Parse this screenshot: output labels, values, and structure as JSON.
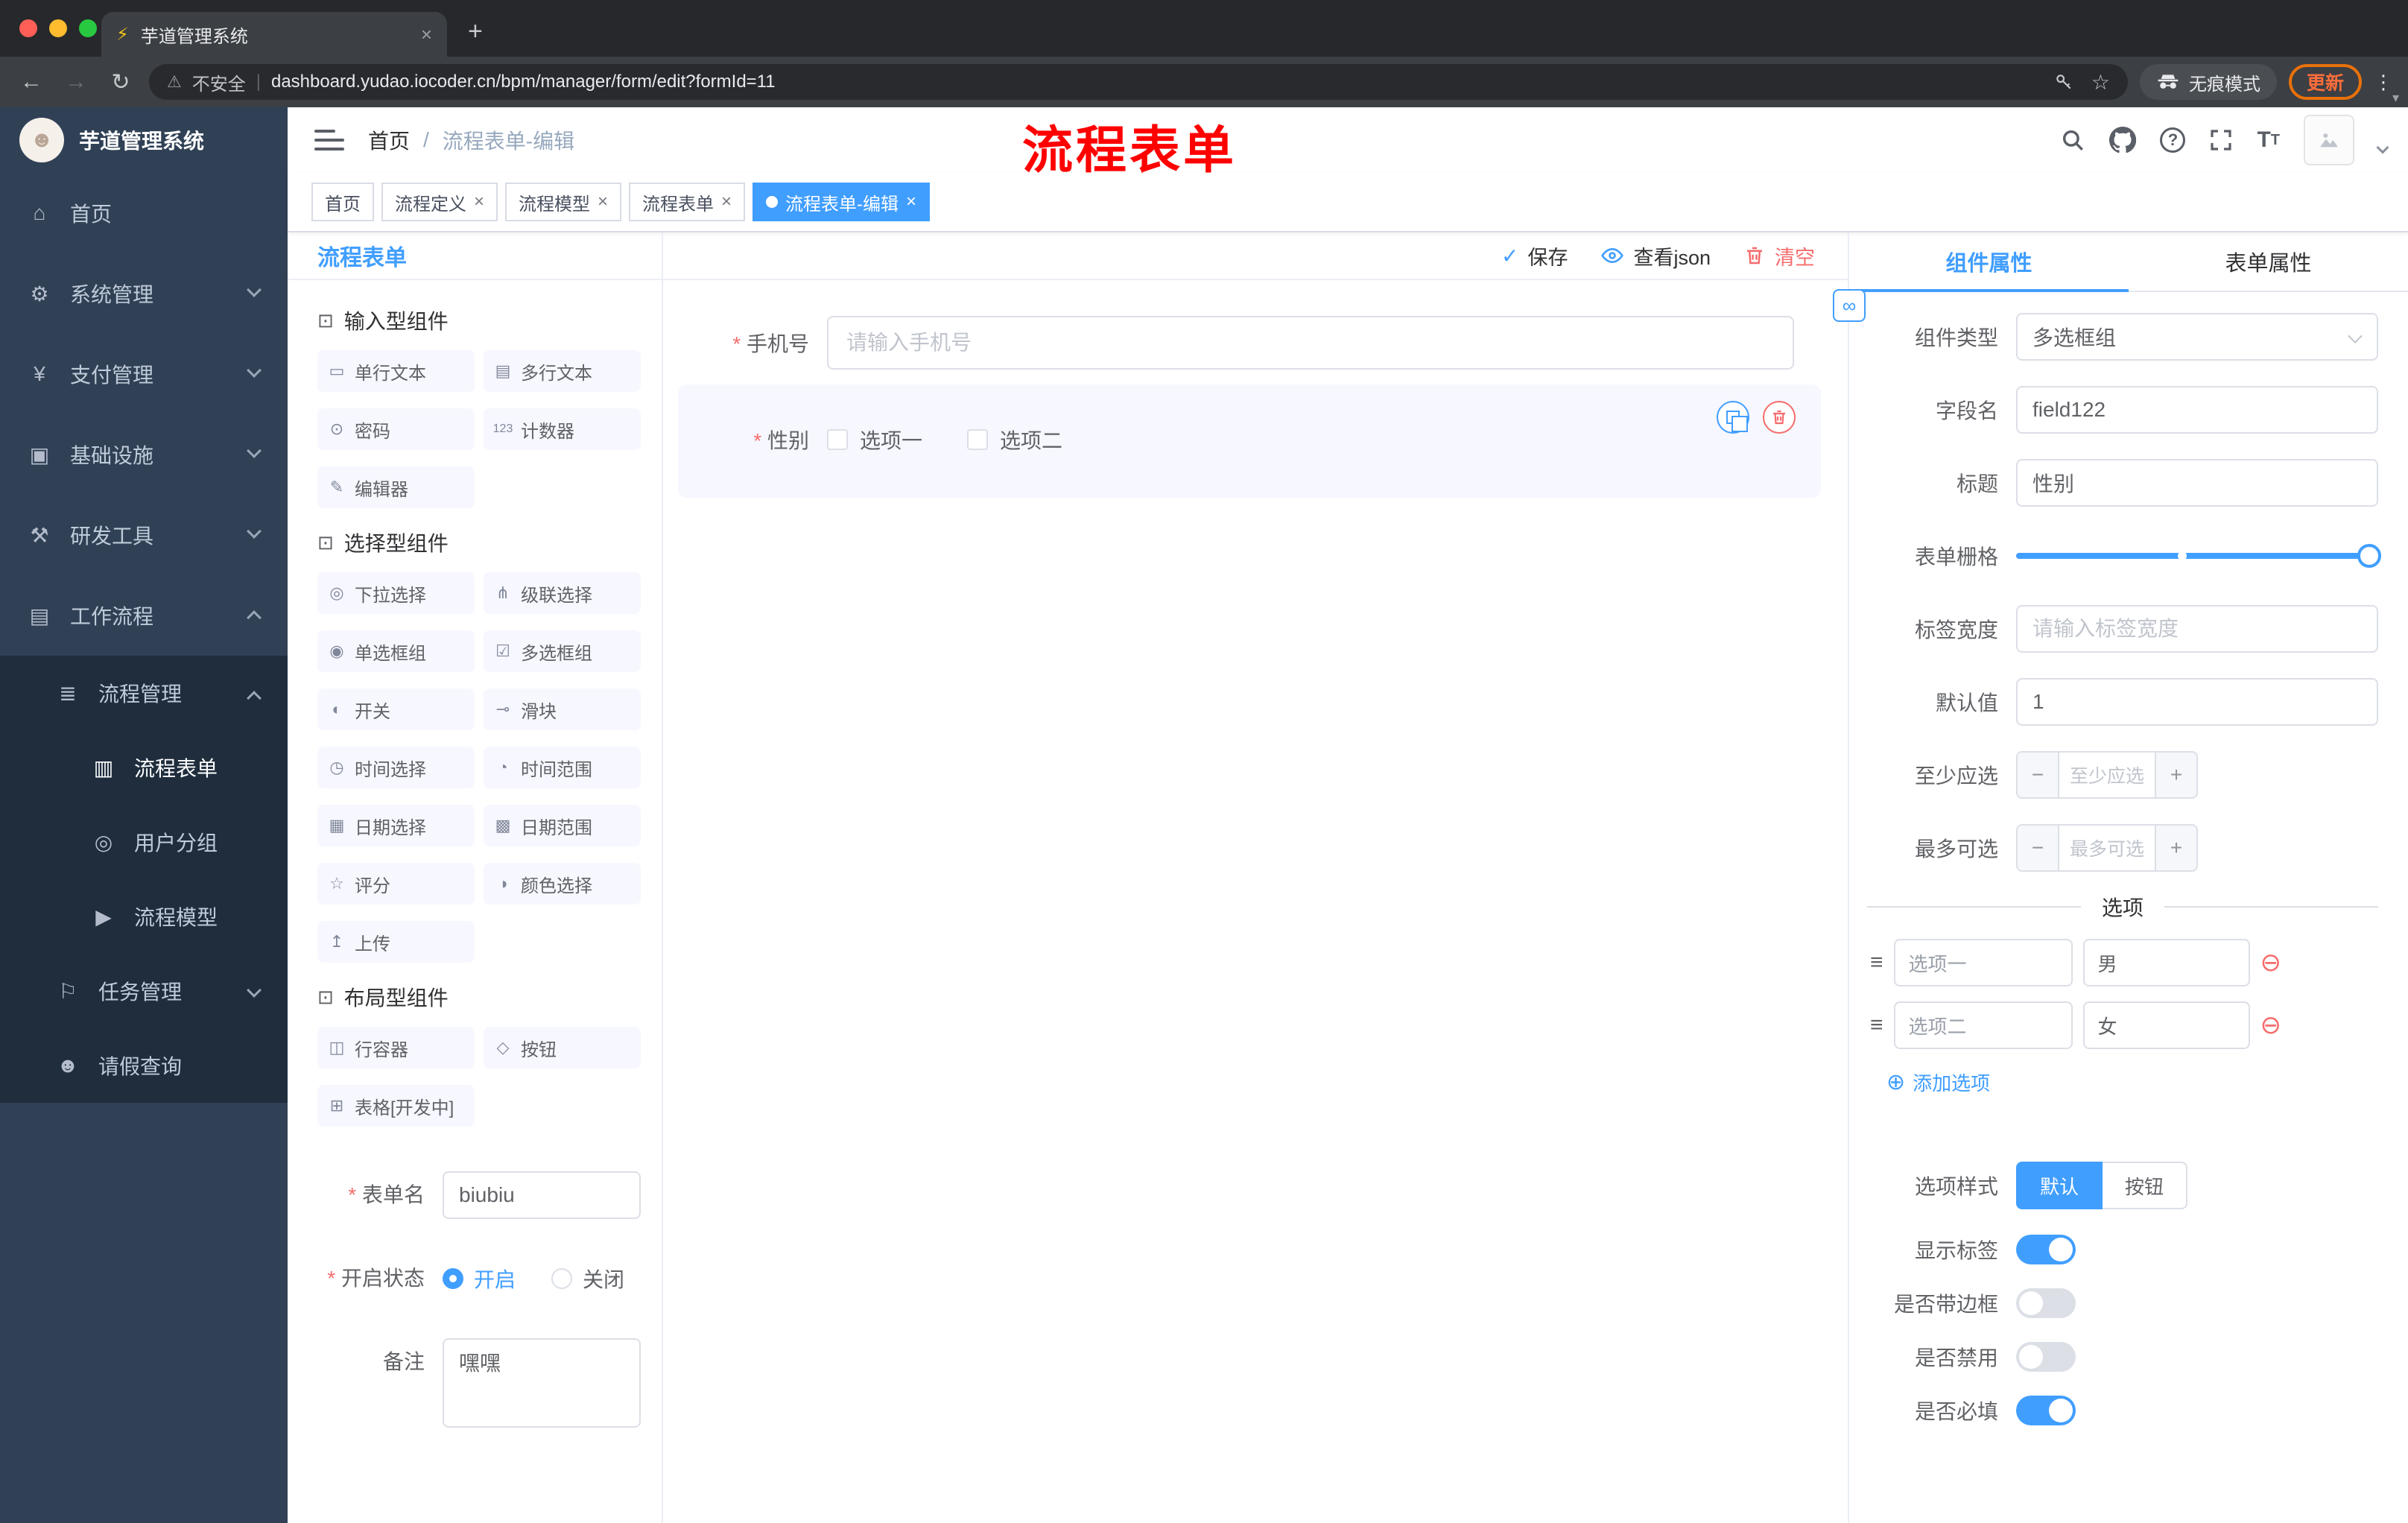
{
  "browser": {
    "tab_title": "芋道管理系统",
    "security": "不安全",
    "url": "dashboard.yudao.iocoder.cn/bpm/manager/form/edit?formId=11",
    "incognito": "无痕模式",
    "update": "更新"
  },
  "sidebar": {
    "title": "芋道管理系统",
    "items": [
      {
        "label": "首页",
        "glyph": "⌂"
      },
      {
        "label": "系统管理",
        "glyph": "⚙"
      },
      {
        "label": "支付管理",
        "glyph": "¥"
      },
      {
        "label": "基础设施",
        "glyph": "▣"
      },
      {
        "label": "研发工具",
        "glyph": "⚒"
      },
      {
        "label": "工作流程",
        "glyph": "▤"
      },
      {
        "label": "流程管理",
        "glyph": "≣"
      },
      {
        "label": "流程表单",
        "glyph": "▥"
      },
      {
        "label": "用户分组",
        "glyph": "◎"
      },
      {
        "label": "流程模型",
        "glyph": "▶"
      },
      {
        "label": "任务管理",
        "glyph": "⚐"
      },
      {
        "label": "请假查询",
        "glyph": "☻"
      }
    ]
  },
  "header": {
    "breadcrumb_home": "首页",
    "breadcrumb_separator": "/",
    "breadcrumb_current": "流程表单-编辑",
    "annotation": "流程表单"
  },
  "tags": {
    "items": [
      {
        "label": "首页"
      },
      {
        "label": "流程定义"
      },
      {
        "label": "流程模型"
      },
      {
        "label": "流程表单"
      },
      {
        "label": "流程表单-编辑"
      }
    ]
  },
  "palette": {
    "title": "流程表单",
    "sections": [
      {
        "title": "输入型组件",
        "items": [
          {
            "label": "单行文本",
            "glyph": "▭"
          },
          {
            "label": "多行文本",
            "glyph": "▤"
          },
          {
            "label": "密码",
            "glyph": "⊙"
          },
          {
            "label": "计数器",
            "glyph": "123"
          },
          {
            "label": "编辑器",
            "glyph": "✎"
          }
        ]
      },
      {
        "title": "选择型组件",
        "items": [
          {
            "label": "下拉选择",
            "glyph": "◎"
          },
          {
            "label": "级联选择",
            "glyph": "⋔"
          },
          {
            "label": "单选框组",
            "glyph": "◉"
          },
          {
            "label": "多选框组",
            "glyph": "☑"
          },
          {
            "label": "开关",
            "glyph": "◐"
          },
          {
            "label": "滑块",
            "glyph": "⊸"
          },
          {
            "label": "时间选择",
            "glyph": "◷"
          },
          {
            "label": "时间范围",
            "glyph": "◔"
          },
          {
            "label": "日期选择",
            "glyph": "▦"
          },
          {
            "label": "日期范围",
            "glyph": "▩"
          },
          {
            "label": "评分",
            "glyph": "☆"
          },
          {
            "label": "颜色选择",
            "glyph": "◑"
          },
          {
            "label": "上传",
            "glyph": "↥"
          }
        ]
      },
      {
        "title": "布局型组件",
        "items": [
          {
            "label": "行容器",
            "glyph": "◫"
          },
          {
            "label": "按钮",
            "glyph": "◇"
          },
          {
            "label": "表格[开发中]",
            "glyph": "⊞"
          }
        ]
      }
    ],
    "form": {
      "name_label": "表单名",
      "name_value": "biubiu",
      "status_label": "开启状态",
      "status_on": "开启",
      "status_off": "关闭",
      "remark_label": "备注",
      "remark_value": "嘿嘿"
    }
  },
  "canvas": {
    "save": "保存",
    "view_json": "查看json",
    "clear": "清空",
    "phone_label": "手机号",
    "phone_placeholder": "请输入手机号",
    "gender_label": "性别",
    "gender_options": [
      {
        "label": "选项一"
      },
      {
        "label": "选项二"
      }
    ]
  },
  "props": {
    "tab_component": "组件属性",
    "tab_form": "表单属性",
    "type_label": "组件类型",
    "type_value": "多选框组",
    "field_label": "字段名",
    "field_value": "field122",
    "title_label": "标题",
    "title_value": "性别",
    "grid_label": "表单栅格",
    "width_label": "标签宽度",
    "width_placeholder": "请输入标签宽度",
    "default_label": "默认值",
    "default_value": "1",
    "min_label": "至少应选",
    "min_placeholder": "至少应选",
    "max_label": "最多可选",
    "max_placeholder": "最多可选",
    "options_divider": "选项",
    "options": [
      {
        "name": "选项一",
        "value": "男"
      },
      {
        "name": "选项二",
        "value": "女"
      }
    ],
    "add_option": "添加选项",
    "style_label": "选项样式",
    "style_default": "默认",
    "style_button": "按钮",
    "show_label": "显示标签",
    "border_label": "是否带边框",
    "disabled_label": "是否禁用",
    "required_label": "是否必填"
  }
}
